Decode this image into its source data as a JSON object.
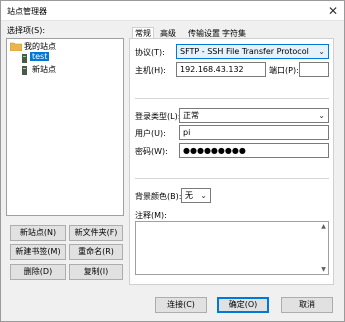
{
  "window": {
    "title": "站点管理器"
  },
  "select_entry_label": "选择项(S):",
  "tree": {
    "root_label": "我的站点",
    "items": [
      {
        "label": "test"
      },
      {
        "label": "新站点"
      }
    ]
  },
  "left_buttons": {
    "new_site": "新站点(N)",
    "new_folder": "新文件夹(F)",
    "new_bookmark": "新建书签(M)",
    "rename": "重命名(R)",
    "delete": "删除(D)",
    "copy": "复制(I)"
  },
  "tabs": [
    "常规",
    "高级",
    "传输设置",
    "字符集"
  ],
  "general": {
    "protocol_label": "协议(T):",
    "protocol_value": "SFTP - SSH File Transfer Protocol",
    "host_label": "主机(H):",
    "host_value": "192.168.43.132",
    "port_label": "端口(P):",
    "port_value": "",
    "logon_type_label": "登录类型(L):",
    "logon_type_value": "正常",
    "user_label": "用户(U):",
    "user_value": "pi",
    "password_label": "密码(W):",
    "password_value": "●●●●●●●●●",
    "bg_color_label": "背景颜色(B):",
    "bg_color_value": "无",
    "comments_label": "注释(M):"
  },
  "bottom_buttons": {
    "connect": "连接(C)",
    "ok": "确定(O)",
    "cancel": "取消"
  },
  "colors": {
    "selection": "#0078d7",
    "tab_active": "#ffffff"
  }
}
